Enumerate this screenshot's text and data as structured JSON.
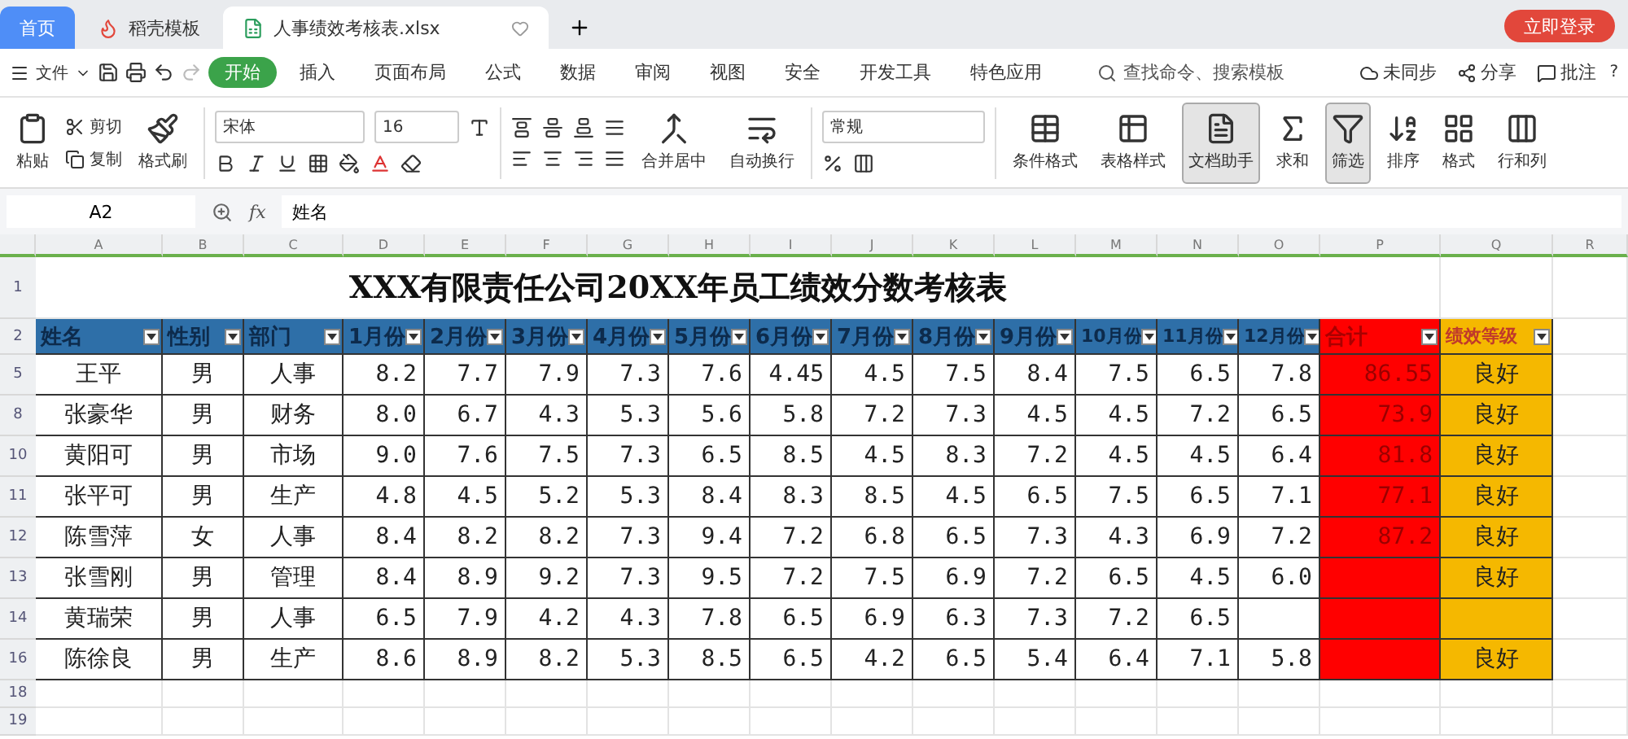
{
  "tabs": [
    {
      "label": "首页",
      "kind": "home",
      "selected": false
    },
    {
      "label": "稻壳模板",
      "kind": "app",
      "selected": false
    },
    {
      "label": "人事绩效考核表.xlsx",
      "kind": "doc",
      "selected": true
    }
  ],
  "account_button": "立即登录",
  "menu": {
    "file": "文件",
    "items": [
      {
        "label": "开始",
        "selected": true
      },
      {
        "label": "插入",
        "selected": false
      },
      {
        "label": "页面布局",
        "selected": false
      },
      {
        "label": "公式",
        "selected": false
      },
      {
        "label": "数据",
        "selected": false
      },
      {
        "label": "审阅",
        "selected": false
      },
      {
        "label": "视图",
        "selected": false
      },
      {
        "label": "安全",
        "selected": false
      },
      {
        "label": "开发工具",
        "selected": false
      },
      {
        "label": "特色应用",
        "selected": false
      }
    ],
    "search_placeholder": "查找命令、搜索模板",
    "actions": [
      "未同步",
      "分享",
      "批注"
    ],
    "help": "?"
  },
  "ribbon": {
    "paste": "粘贴",
    "cut": "剪切",
    "copy": "复制",
    "format_painter": "格式刷",
    "font": "宋体",
    "font_size": "16",
    "merge": "合并居中",
    "wrap": "自动换行",
    "number_format": "常规",
    "tools": [
      {
        "label": "条件格式",
        "selected": false
      },
      {
        "label": "表格样式",
        "selected": false
      },
      {
        "label": "文档助手",
        "selected": true
      },
      {
        "label": "求和",
        "selected": false
      },
      {
        "label": "筛选",
        "selected": true
      },
      {
        "label": "排序",
        "selected": false
      },
      {
        "label": "格式",
        "selected": false
      },
      {
        "label": "行和列",
        "selected": false
      }
    ]
  },
  "formula_bar": {
    "cell": "A2",
    "fx": "fx",
    "value": "姓名"
  },
  "sheet": {
    "column_letters": [
      "A",
      "B",
      "C",
      "D",
      "E",
      "F",
      "G",
      "H",
      "I",
      "J",
      "K",
      "L",
      "M",
      "N",
      "O",
      "P",
      "Q",
      "R"
    ],
    "title_row": "1",
    "title": "XXX有限责任公司20XX年员工绩效分数考核表",
    "header_row": "2",
    "columns": [
      {
        "label": "姓名",
        "kind": "info"
      },
      {
        "label": "性别",
        "kind": "info"
      },
      {
        "label": "部门",
        "kind": "info"
      },
      {
        "label": "1月份",
        "kind": "month"
      },
      {
        "label": "2月份",
        "kind": "month"
      },
      {
        "label": "3月份",
        "kind": "month"
      },
      {
        "label": "4月份",
        "kind": "month"
      },
      {
        "label": "5月份",
        "kind": "month"
      },
      {
        "label": "6月份",
        "kind": "month"
      },
      {
        "label": "7月份",
        "kind": "month"
      },
      {
        "label": "8月份",
        "kind": "month"
      },
      {
        "label": "9月份",
        "kind": "month"
      },
      {
        "label": "10月份",
        "kind": "month"
      },
      {
        "label": "11月份",
        "kind": "month"
      },
      {
        "label": "12月份",
        "kind": "month"
      },
      {
        "label": "合计",
        "kind": "total"
      },
      {
        "label": "绩效等级",
        "kind": "grade"
      }
    ],
    "rows": [
      {
        "row": "5",
        "cells": [
          "王平",
          "男",
          "人事",
          "8.2",
          "7.7",
          "7.9",
          "7.3",
          "7.6",
          "4.45",
          "4.5",
          "7.5",
          "8.4",
          "7.5",
          "6.5",
          "7.8",
          "86.55",
          "良好"
        ]
      },
      {
        "row": "8",
        "cells": [
          "张豪华",
          "男",
          "财务",
          "8.0",
          "6.7",
          "4.3",
          "5.3",
          "5.6",
          "5.8",
          "7.2",
          "7.3",
          "4.5",
          "4.5",
          "7.2",
          "6.5",
          "73.9",
          "良好"
        ]
      },
      {
        "row": "10",
        "cells": [
          "黄阳可",
          "男",
          "市场",
          "9.0",
          "7.6",
          "7.5",
          "7.3",
          "6.5",
          "8.5",
          "4.5",
          "8.3",
          "7.2",
          "4.5",
          "4.5",
          "6.4",
          "81.8",
          "良好"
        ]
      },
      {
        "row": "11",
        "cells": [
          "张平可",
          "男",
          "生产",
          "4.8",
          "4.5",
          "5.2",
          "5.3",
          "8.4",
          "8.3",
          "8.5",
          "4.5",
          "6.5",
          "7.5",
          "6.5",
          "7.1",
          "77.1",
          "良好"
        ]
      },
      {
        "row": "12",
        "cells": [
          "陈雪萍",
          "女",
          "人事",
          "8.4",
          "8.2",
          "8.2",
          "7.3",
          "9.4",
          "7.2",
          "6.8",
          "6.5",
          "7.3",
          "4.3",
          "6.9",
          "7.2",
          "87.2",
          "良好"
        ]
      },
      {
        "row": "13",
        "cells": [
          "张雪刚",
          "男",
          "管理",
          "8.4",
          "8.9",
          "9.2",
          "7.3",
          "9.5",
          "7.2",
          "7.5",
          "6.9",
          "7.2",
          "6.5",
          "4.5",
          "6.0",
          null,
          "良好"
        ]
      },
      {
        "row": "14",
        "cells": [
          "黄瑞荣",
          "男",
          "人事",
          "6.5",
          "7.9",
          "4.2",
          "4.3",
          "7.8",
          "6.5",
          "6.9",
          "6.3",
          "7.3",
          "7.2",
          "6.5",
          null,
          null,
          null
        ]
      },
      {
        "row": "16",
        "cells": [
          "陈徐良",
          "男",
          "生产",
          "8.6",
          "8.9",
          "8.2",
          "5.3",
          "8.5",
          "6.5",
          "4.2",
          "6.5",
          "5.4",
          "6.4",
          "7.1",
          "5.8",
          null,
          "良好"
        ]
      }
    ],
    "empty_rows": [
      "18",
      "19"
    ]
  }
}
